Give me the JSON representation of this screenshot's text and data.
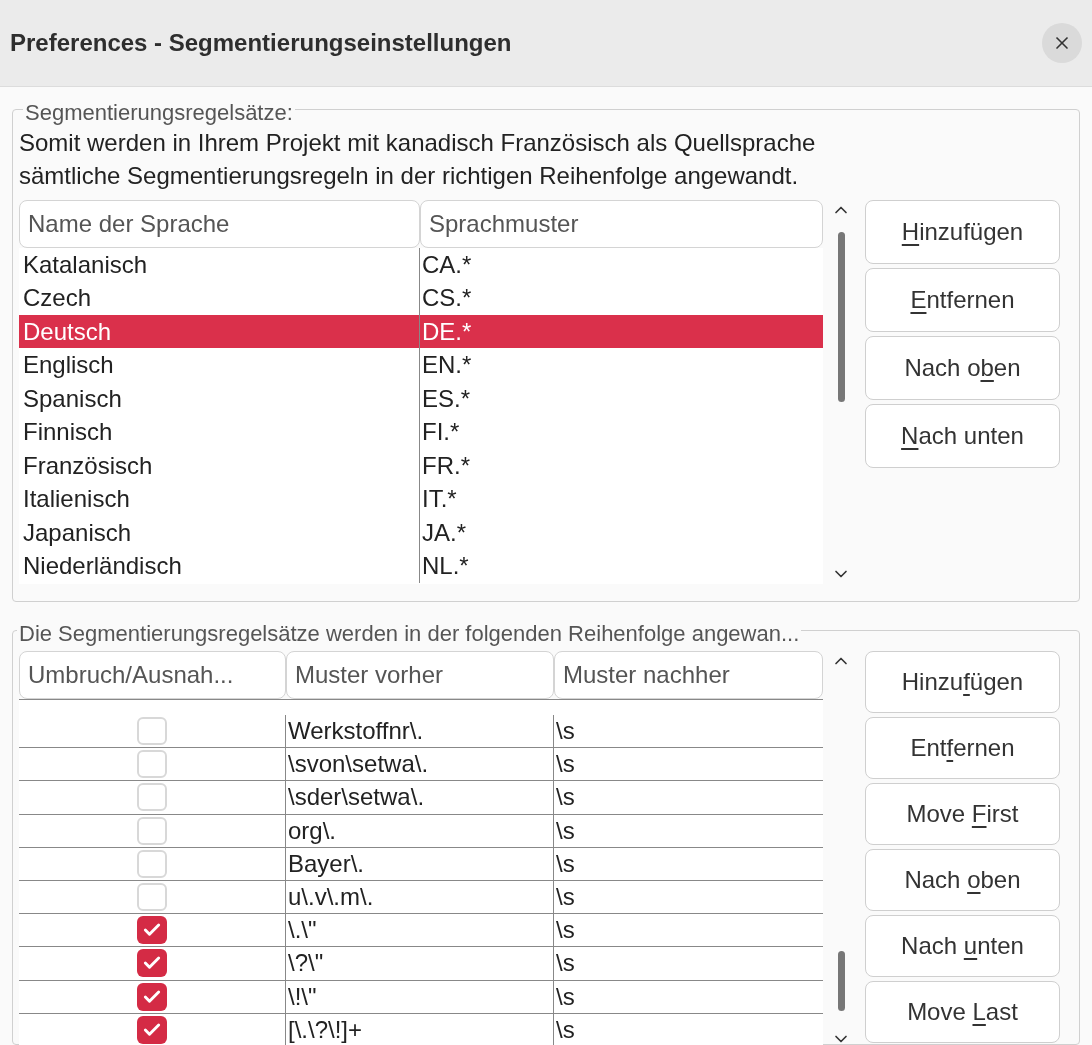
{
  "window": {
    "title": "Preferences - Segmentierungseinstellungen"
  },
  "rule_sets": {
    "legend": "Segmentierungsregelsätze:",
    "description": [
      "Somit werden in Ihrem Projekt mit kanadisch Französisch als Quellsprache",
      "sämtliche Segmentierungsregeln in der richtigen Reihenfolge angewandt."
    ],
    "columns": [
      "Name der Sprache",
      "Sprachmuster"
    ],
    "rows": [
      {
        "name": "Katalanisch",
        "pattern": "CA.*",
        "selected": false
      },
      {
        "name": "Czech",
        "pattern": "CS.*",
        "selected": false
      },
      {
        "name": "Deutsch",
        "pattern": "DE.*",
        "selected": true
      },
      {
        "name": "Englisch",
        "pattern": "EN.*",
        "selected": false
      },
      {
        "name": "Spanisch",
        "pattern": "ES.*",
        "selected": false
      },
      {
        "name": "Finnisch",
        "pattern": "FI.*",
        "selected": false
      },
      {
        "name": "Französisch",
        "pattern": "FR.*",
        "selected": false
      },
      {
        "name": "Italienisch",
        "pattern": "IT.*",
        "selected": false
      },
      {
        "name": "Japanisch",
        "pattern": "JA.*",
        "selected": false
      },
      {
        "name": "Niederländisch",
        "pattern": "NL.*",
        "selected": false
      }
    ],
    "buttons": [
      {
        "key": "H",
        "post": "inzufügen"
      },
      {
        "key": "E",
        "post": "ntfernen"
      },
      {
        "pre": "Nach o",
        "key": "b",
        "post": "en"
      },
      {
        "key": "N",
        "post": "ach unten"
      }
    ]
  },
  "rules": {
    "legend": "Die Segmentierungsregelsätze werden in der folgenden Reihenfolge angewan...",
    "columns": [
      "Umbruch/Ausnah...",
      "Muster vorher",
      "Muster nachher"
    ],
    "rows": [
      {
        "checked": false,
        "before": "Werkstoffnr\\.",
        "after": "\\s"
      },
      {
        "checked": false,
        "before": "\\svon\\setwa\\.",
        "after": "\\s"
      },
      {
        "checked": false,
        "before": "\\sder\\setwa\\.",
        "after": "\\s"
      },
      {
        "checked": false,
        "before": "org\\.",
        "after": "\\s"
      },
      {
        "checked": false,
        "before": "Bayer\\.",
        "after": "\\s"
      },
      {
        "checked": false,
        "before": "u\\.v\\.m\\.",
        "after": "\\s"
      },
      {
        "checked": true,
        "before": "\\.\\\"",
        "after": "\\s"
      },
      {
        "checked": true,
        "before": "\\?\\\"",
        "after": "\\s"
      },
      {
        "checked": true,
        "before": "\\!\\\"",
        "after": "\\s"
      },
      {
        "checked": true,
        "before": "[\\.\\?\\!]+",
        "after": "\\s"
      }
    ],
    "buttons": [
      {
        "pre": "Hinzu",
        "key": "f",
        "post": "ügen"
      },
      {
        "pre": "Ent",
        "key": "f",
        "post": "ernen"
      },
      {
        "pre": "Move ",
        "key": "F",
        "post": "irst"
      },
      {
        "pre": "Nach ",
        "key": "o",
        "post": "ben"
      },
      {
        "pre": "Nach ",
        "key": "u",
        "post": "nten"
      },
      {
        "pre": "Move ",
        "key": "L",
        "post": "ast"
      }
    ]
  }
}
